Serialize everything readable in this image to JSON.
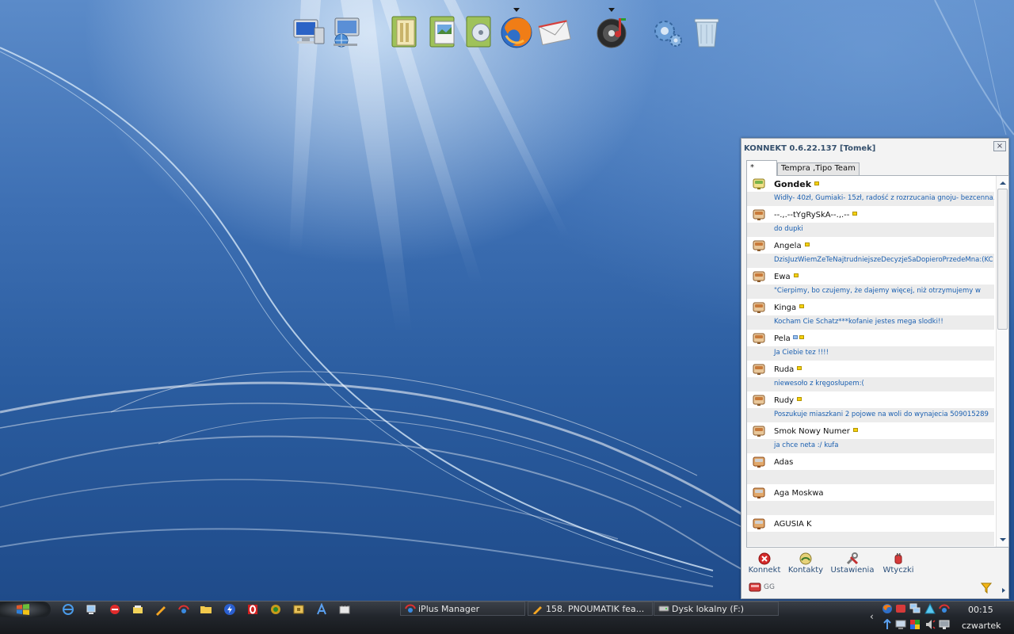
{
  "dock": {
    "icons": [
      "my-computer-icon",
      "network-icon",
      "documents-folder-icon",
      "pictures-folder-icon",
      "music-folder-icon",
      "firefox-icon",
      "mail-icon",
      "media-player-icon",
      "settings-gear-icon",
      "recycle-bin-icon"
    ]
  },
  "konnekt": {
    "title": "KONNEKT 0.6.22.137 [Tomek]",
    "close_label": "×",
    "tabs": [
      {
        "label": "*",
        "active": true
      },
      {
        "label": "Tempra ,Tipo Team",
        "active": false
      }
    ],
    "contacts": [
      {
        "name": "Gondek",
        "description": "Widły- 40zł, Gumiaki- 15zł, radość z rozrzucania gnoju- bezcenna...",
        "flag": true,
        "bold": true,
        "status": "online"
      },
      {
        "name": "--.,.--tYgRySkA--.,.--",
        "description": "do dupki",
        "flag": true,
        "status": "away"
      },
      {
        "name": "Angela",
        "description": "DzisJuzWiemZeTeNajtrudniejszeDecyzjeSaDopieroPrzedeMna:(KC",
        "flag": true,
        "status": "away"
      },
      {
        "name": "Ewa",
        "description": "\"Cierpimy, bo czujemy, że dajemy więcej, niż otrzymujemy w",
        "flag": true,
        "status": "away"
      },
      {
        "name": "Kinga",
        "description": "Kocham Cie Schatz***kofanie jestes mega slodki!!",
        "flag": true,
        "status": "away"
      },
      {
        "name": "Pela",
        "description": "Ja Ciebie tez !!!!",
        "flag": true,
        "extra_flag": true,
        "status": "away"
      },
      {
        "name": "Ruda",
        "description": "niewesoło z kręgosłupem:(",
        "flag": true,
        "status": "away"
      },
      {
        "name": "Rudy",
        "description": "Poszukuje miaszkani 2 pojowe na woli do wynajecia 509015289",
        "flag": true,
        "status": "away"
      },
      {
        "name": "Smok Nowy Numer",
        "description": "ja chce neta :/ kufa",
        "flag": true,
        "status": "away"
      },
      {
        "name": "Adas",
        "description": "",
        "flag": false,
        "status": "offline"
      },
      {
        "name": "Aga Moskwa",
        "description": "",
        "flag": false,
        "status": "offline"
      },
      {
        "name": "AGUSIA K",
        "description": "",
        "flag": false,
        "status": "offline"
      }
    ],
    "toolbar": {
      "konnekt": "Konnekt",
      "kontakty": "Kontakty",
      "ustawienia": "Ustawienia",
      "wtyczki": "Wtyczki"
    },
    "status_label": "GG"
  },
  "taskbar": {
    "tasks": [
      "iPlus Manager",
      "158. PNOUMATIK fea...",
      "Dysk lokalny (F:)"
    ],
    "time": "00:15",
    "day": "czwartek",
    "tray_arrow": "‹"
  },
  "colors": {
    "desktop_blue": "#2a5c9f",
    "link_blue": "#1a5fb0",
    "taskbar_dark": "#22262c"
  }
}
